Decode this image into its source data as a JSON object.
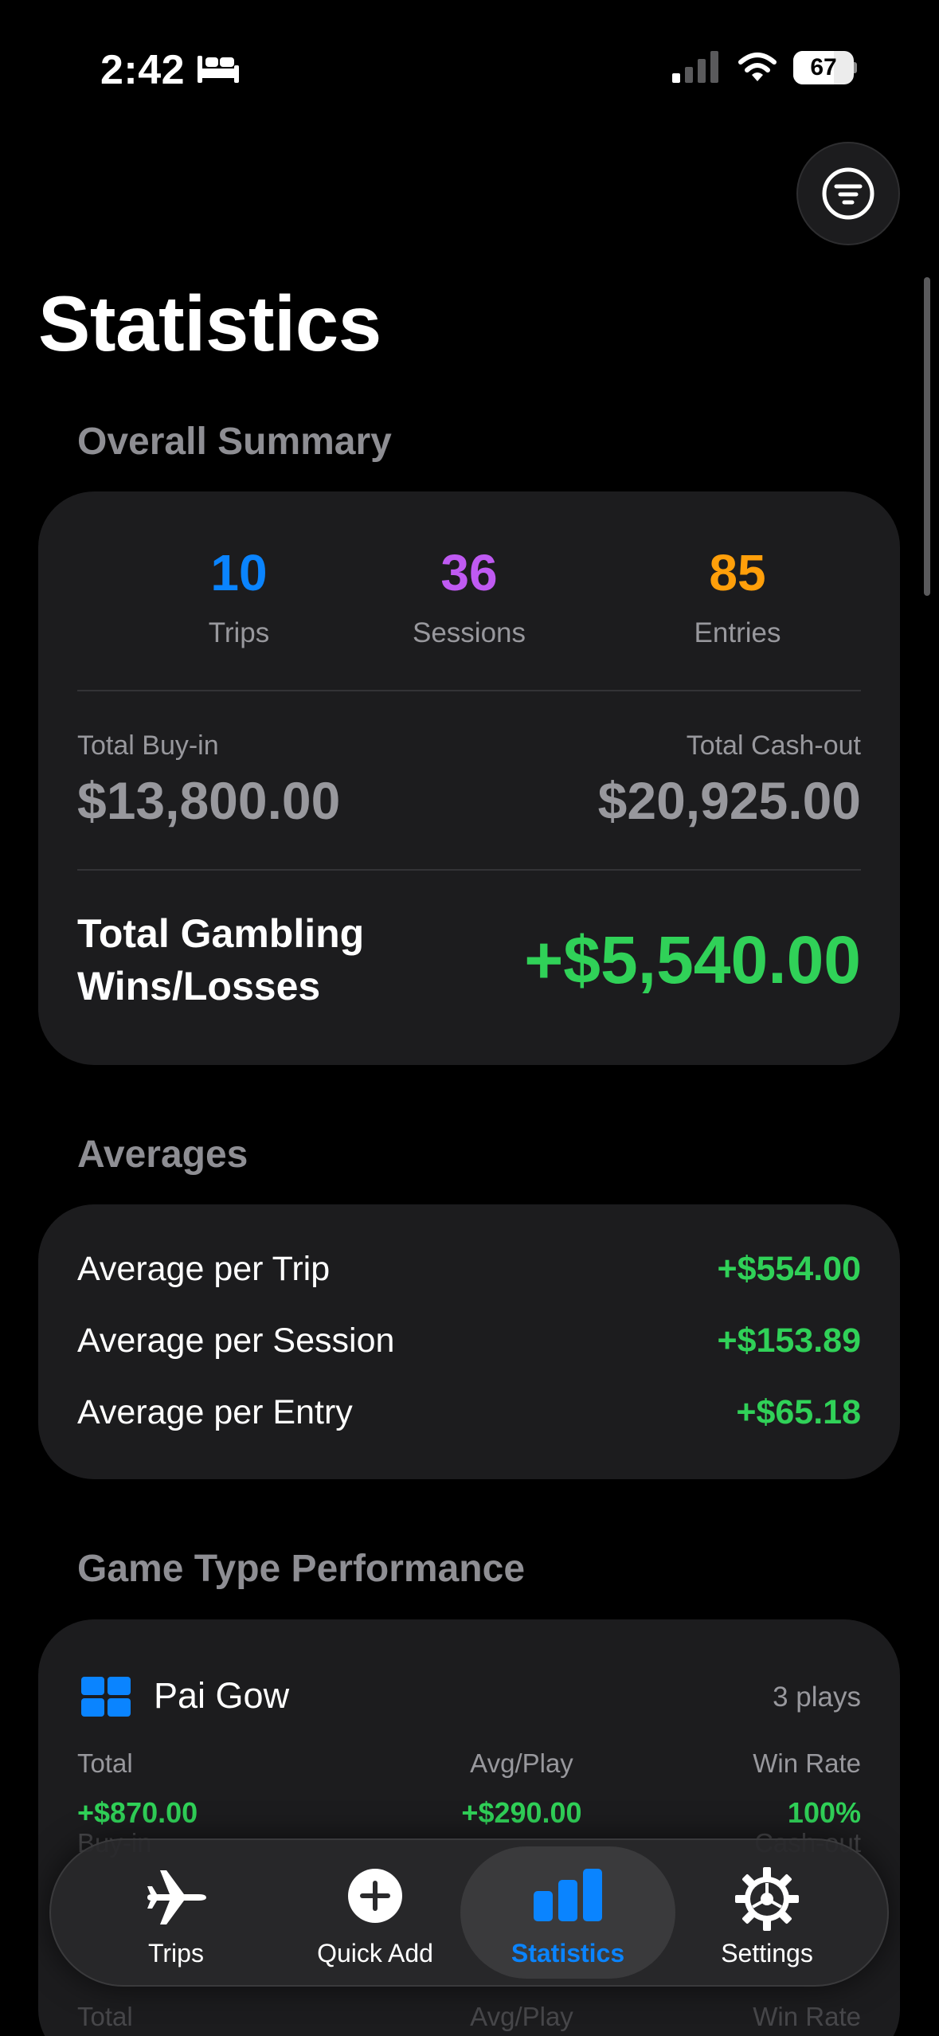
{
  "status_bar": {
    "time": "2:42",
    "battery_percent": "67",
    "battery_level": 0.67
  },
  "header": {
    "title": "Statistics"
  },
  "overall_summary": {
    "header": "Overall Summary",
    "counts": [
      {
        "value": "10",
        "label": "Trips",
        "color": "#0a84ff"
      },
      {
        "value": "36",
        "label": "Sessions",
        "color": "#bf5af2"
      },
      {
        "value": "85",
        "label": "Entries",
        "color": "#ff9f0a"
      }
    ],
    "buyin_label": "Total Buy-in",
    "buyin_value": "$13,800.00",
    "cashout_label": "Total Cash-out",
    "cashout_value": "$20,925.00",
    "net_label": "Total Gambling Wins/Losses",
    "net_value": "+$5,540.00"
  },
  "averages": {
    "header": "Averages",
    "rows": [
      {
        "label": "Average per Trip",
        "value": "+$554.00"
      },
      {
        "label": "Average per Session",
        "value": "+$153.89"
      },
      {
        "label": "Average per Entry",
        "value": "+$65.18"
      }
    ]
  },
  "game_performance": {
    "header": "Game Type Performance",
    "games": [
      {
        "name": "Pai Gow",
        "plays": "3 plays",
        "total_label": "Total",
        "total_value": "+$870.00",
        "avg_label": "Avg/Play",
        "avg_value": "+$290.00",
        "winrate_label": "Win Rate",
        "winrate_value": "100%",
        "buyin_label": "Buy-in",
        "cashout_label": "Cash-out"
      }
    ],
    "next_row": {
      "total_label": "Total",
      "avg_label": "Avg/Play",
      "winrate_label": "Win Rate"
    }
  },
  "tab_bar": {
    "tabs": [
      {
        "label": "Trips",
        "icon": "airplane-icon"
      },
      {
        "label": "Quick Add",
        "icon": "plus-circle-icon"
      },
      {
        "label": "Statistics",
        "icon": "bar-chart-icon",
        "active": true
      },
      {
        "label": "Settings",
        "icon": "gear-icon"
      }
    ]
  },
  "colors": {
    "positive": "#30d158",
    "accent": "#0a84ff",
    "card": "#1c1c1e"
  }
}
